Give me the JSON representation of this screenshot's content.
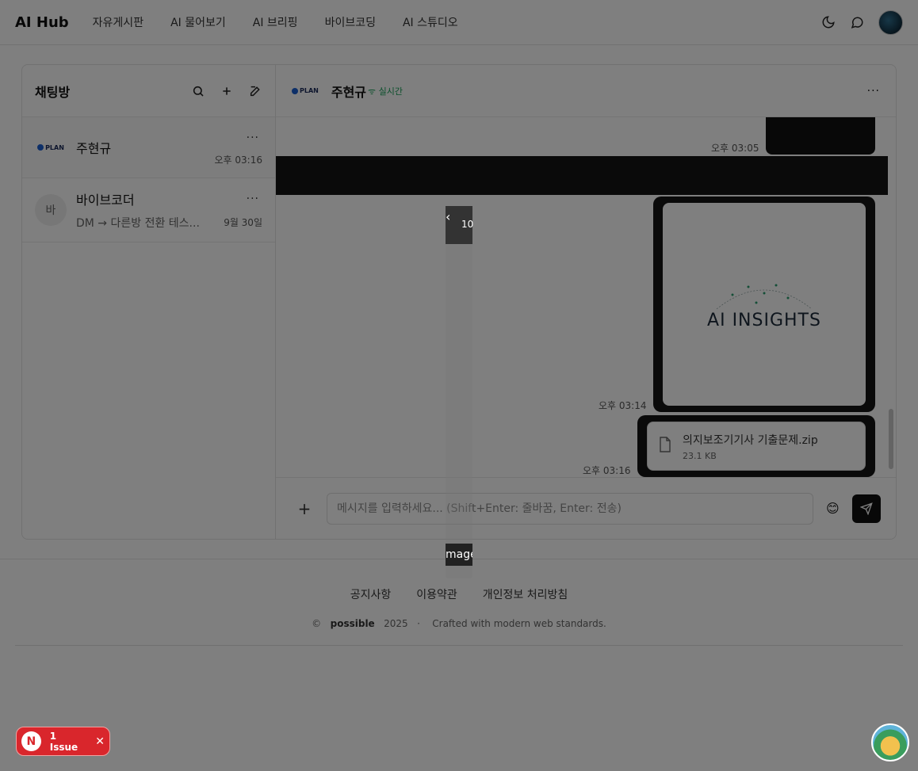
{
  "header": {
    "logo": "AI Hub",
    "nav": [
      "자유게시판",
      "AI 물어보기",
      "AI 브리핑",
      "바이브코딩",
      "AI 스튜디오"
    ]
  },
  "sidebar": {
    "title": "채팅방",
    "rooms": [
      {
        "name": "주현규",
        "preview": "",
        "time": "오후 03:16",
        "avatar": "PLAN"
      },
      {
        "name": "바이브코더",
        "preview": "DM → 다른방 전환 테스...",
        "time": "9월 30일",
        "avatar": "바"
      }
    ]
  },
  "chat": {
    "name": "주현규",
    "status": "실시간",
    "avatar": "PLAN",
    "messages": [
      {
        "time": "오후 03:05"
      },
      {
        "time": "오후 03:14",
        "image_text": "AI INSIGHTS"
      },
      {
        "time": "오후 03:16",
        "file_name": "의지보조기기사 기출문제.zip",
        "file_size": "23.1 KB"
      }
    ],
    "input_placeholder": "메시지를 입력하세요... (Shift+Enter: 줄바꿈, Enter: 전송)"
  },
  "viewer": {
    "counter": "10",
    "caption": "mage"
  },
  "footer": {
    "links": [
      "공지사항",
      "이용약관",
      "개인정보 처리방침"
    ],
    "copyright_symbol": "©",
    "brand": "possible",
    "year": "2025",
    "separator": "·",
    "tagline": "Crafted with modern web standards."
  },
  "issue_badge": {
    "letter": "N",
    "text": "1 Issue"
  }
}
